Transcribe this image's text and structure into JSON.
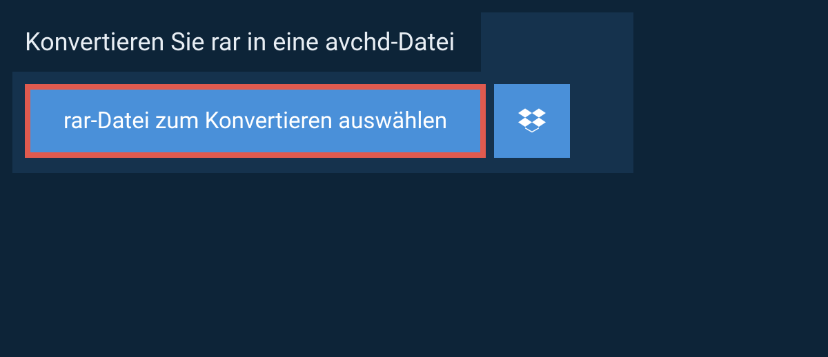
{
  "heading": "Konvertieren Sie rar in eine avchd-Datei",
  "buttons": {
    "select_file": "rar-Datei zum Konvertieren auswählen"
  }
}
